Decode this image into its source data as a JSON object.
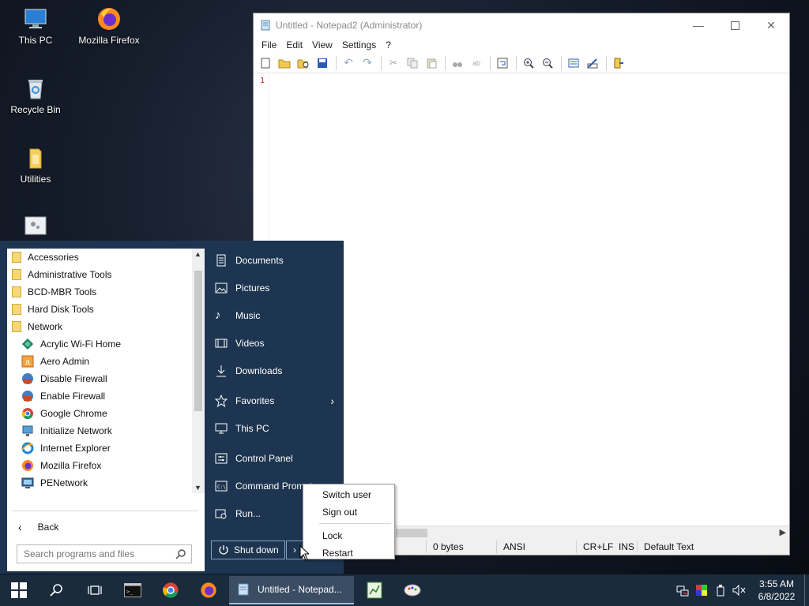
{
  "desktop": {
    "icons": [
      {
        "label": "This PC",
        "icon": "computer-icon"
      },
      {
        "label": "Mozilla Firefox",
        "icon": "firefox-icon"
      },
      {
        "label": "Recycle Bin",
        "icon": "recycle-bin-icon"
      },
      {
        "label": "Utilities",
        "icon": "folder-icon"
      },
      {
        "label": "",
        "icon": "settings-shortcut-icon"
      }
    ]
  },
  "notepad": {
    "title": "Untitled - Notepad2 (Administrator)",
    "menu": [
      "File",
      "Edit",
      "View",
      "Settings",
      "?"
    ],
    "line_number": "1",
    "status": {
      "size": "0 bytes",
      "encoding": "ANSI",
      "line_ending": "CR+LF",
      "mode": "INS",
      "scheme": "Default Text"
    }
  },
  "start_menu": {
    "programs": [
      {
        "label": "Accessories",
        "type": "folder"
      },
      {
        "label": "Administrative Tools",
        "type": "folder"
      },
      {
        "label": "BCD-MBR Tools",
        "type": "folder"
      },
      {
        "label": "Hard Disk Tools",
        "type": "folder"
      },
      {
        "label": "Network",
        "type": "folder"
      },
      {
        "label": "Acrylic Wi-Fi Home",
        "type": "app"
      },
      {
        "label": "Aero Admin",
        "type": "app"
      },
      {
        "label": "Disable Firewall",
        "type": "app"
      },
      {
        "label": "Enable Firewall",
        "type": "app"
      },
      {
        "label": "Google Chrome",
        "type": "app"
      },
      {
        "label": "Initialize Network",
        "type": "app"
      },
      {
        "label": "Internet Explorer",
        "type": "app"
      },
      {
        "label": "Mozilla Firefox",
        "type": "app"
      },
      {
        "label": "PENetwork",
        "type": "app"
      }
    ],
    "back_label": "Back",
    "search_placeholder": "Search programs and files",
    "right_items": {
      "documents": "Documents",
      "pictures": "Pictures",
      "music": "Music",
      "videos": "Videos",
      "downloads": "Downloads",
      "favorites": "Favorites",
      "this_pc": "This PC",
      "control_panel": "Control Panel",
      "command_prompt": "Command Prompt",
      "run": "Run..."
    },
    "shutdown_label": "Shut down"
  },
  "power_menu": {
    "switch_user": "Switch user",
    "sign_out": "Sign out",
    "lock": "Lock",
    "restart": "Restart"
  },
  "taskbar": {
    "active_window": "Untitled - Notepad...",
    "clock_time": "3:55 AM",
    "clock_date": "6/8/2022"
  }
}
